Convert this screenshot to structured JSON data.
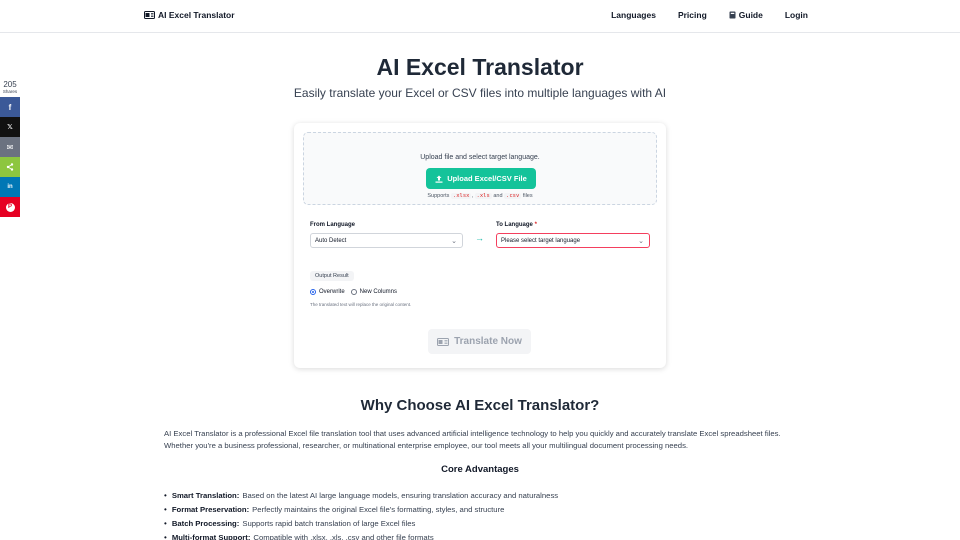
{
  "header": {
    "brand": "AI Excel Translator",
    "nav": [
      "Languages",
      "Pricing",
      "Guide",
      "Login"
    ]
  },
  "share": {
    "count": "205",
    "label": "Shares",
    "buttons": [
      {
        "name": "facebook",
        "glyph": "f",
        "color": "#3b5998"
      },
      {
        "name": "x",
        "glyph": "𝕏",
        "color": "#111111"
      },
      {
        "name": "email",
        "glyph": "✉",
        "color": "#6b7280"
      },
      {
        "name": "share",
        "glyph": "<",
        "color": "#8dc63f"
      },
      {
        "name": "linkedin",
        "glyph": "in",
        "color": "#0077b5"
      },
      {
        "name": "pinterest",
        "glyph": "P",
        "color": "#e60023"
      }
    ]
  },
  "hero": {
    "title": "AI Excel Translator",
    "subtitle": "Easily translate your Excel or CSV files into multiple languages with AI"
  },
  "upload": {
    "instruction": "Upload file and select target language.",
    "button": "Upload Excel/CSV File",
    "supports_prefix": "Supports",
    "formats": [
      ".xlsx",
      ".xls",
      ".csv"
    ],
    "and": "and",
    "files": "files"
  },
  "languages": {
    "from_label": "From Language",
    "from_value": "Auto Detect",
    "to_label": "To Language",
    "required": "*",
    "to_value": "Please select target language"
  },
  "output": {
    "label": "Output Result",
    "options": [
      "Overwrite",
      "New Columns"
    ],
    "selected": "Overwrite",
    "hint": "The translated text will replace the original content."
  },
  "translate_button": "Translate Now",
  "content": {
    "why_title": "Why Choose AI Excel Translator?",
    "paragraph": "AI Excel Translator is a professional Excel file translation tool that uses advanced artificial intelligence technology to help you quickly and accurately translate Excel spreadsheet files. Whether you're a business professional, researcher, or multinational enterprise employee, our tool meets all your multilingual document processing needs.",
    "core_title": "Core Advantages",
    "advantages": [
      {
        "title": "Smart Translation:",
        "text": "Based on the latest AI large language models, ensuring translation accuracy and naturalness"
      },
      {
        "title": "Format Preservation:",
        "text": "Perfectly maintains the original Excel file's formatting, styles, and structure"
      },
      {
        "title": "Batch Processing:",
        "text": "Supports rapid batch translation of large Excel files"
      },
      {
        "title": "Multi-format Support:",
        "text": "Compatible with .xlsx, .xls, .csv and other file formats"
      }
    ]
  },
  "colors": {
    "accent": "#14c39a",
    "error": "#f43f5e"
  }
}
